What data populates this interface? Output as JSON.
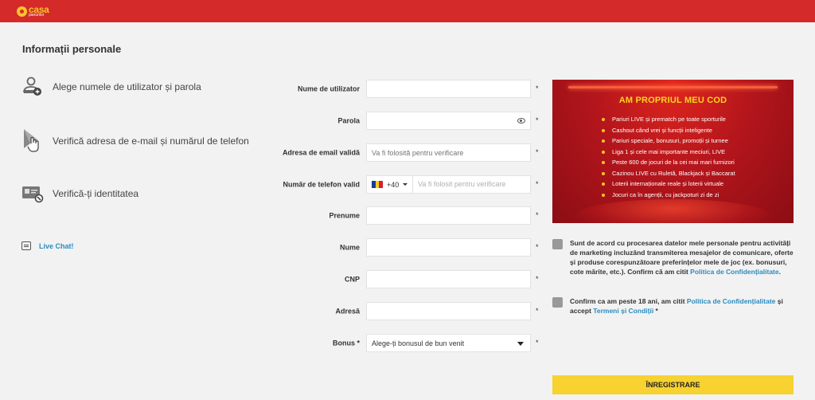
{
  "header": {
    "logo_main": "casa",
    "logo_sub": "pariurilor",
    "brand_color": "#d42a2a",
    "accent_color": "#f7c42b"
  },
  "page_title": "Informații personale",
  "steps": [
    {
      "icon": "user-add-icon",
      "label": "Alege numele de utilizator și parola"
    },
    {
      "icon": "cursor-click-icon",
      "label": "Verifică adresa de e-mail și numărul de telefon"
    },
    {
      "icon": "id-card-icon",
      "label": "Verifică-ți identitatea"
    }
  ],
  "live_chat": {
    "label": "Live Chat!"
  },
  "form": {
    "username": {
      "label": "Nume de utilizator",
      "placeholder": ""
    },
    "password": {
      "label": "Parola",
      "placeholder": ""
    },
    "email": {
      "label": "Adresa de email validă",
      "placeholder": "Va fi folosită pentru verificare"
    },
    "phone": {
      "label": "Număr de telefon valid",
      "code": "+40",
      "placeholder": "Va fi folosit pentru verificare"
    },
    "first_name": {
      "label": "Prenume",
      "placeholder": ""
    },
    "last_name": {
      "label": "Nume",
      "placeholder": ""
    },
    "cnp": {
      "label": "CNP",
      "placeholder": ""
    },
    "address": {
      "label": "Adresă",
      "placeholder": ""
    },
    "bonus": {
      "label": "Bonus *",
      "selected": "Alege-ți bonusul de bun venit"
    },
    "required_mark": "*"
  },
  "promo": {
    "title": "AM PROPRIUL MEU COD",
    "items": [
      "Pariuri LIVE și prematch pe toate sporturile",
      "Cashout când vrei și funcții inteligente",
      "Pariuri speciale, bonusuri, promoții și turnee",
      "Liga 1 și cele mai importante meciuri, LIVE",
      "Peste 600 de jocuri de la cei mai mari furnizori",
      "Cazinou LIVE cu Ruletă, Blackjack și Baccarat",
      "Loterii internaționale reale și loterii virtuale",
      "Jocuri ca în agenții, cu jackpoturi zi de zi"
    ]
  },
  "consent_marketing": {
    "text": "Sunt de acord cu procesarea datelor mele personale pentru activități de marketing incluzând transmiterea mesajelor de comunicare, oferte și produse corespunzătoare preferințelor mele de joc (ex. bonusuri, cote mărite, etc.). Confirm că am citit ",
    "link": "Politica de Confidențialitate",
    "end": "."
  },
  "consent_age": {
    "text": "Confirm ca am peste 18 ani, am citit ",
    "link1": "Politica de Confidențialitate",
    "mid": " și accept ",
    "link2": "Termeni și Condiții",
    "end": " *"
  },
  "register_button": "ÎNREGISTRARE"
}
